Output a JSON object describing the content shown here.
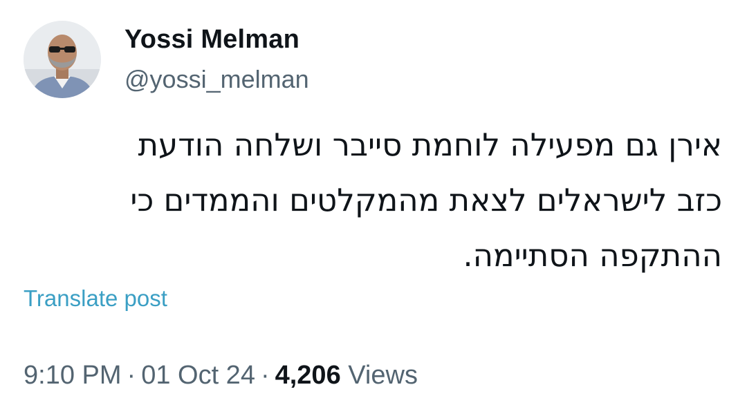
{
  "author": {
    "display_name": "Yossi Melman",
    "handle": "@yossi_melman"
  },
  "post": {
    "lines": [
      "אירן גם מפעילה לוחמת סייבר ושלחה הודעת",
      "כזב לישראלים לצאת מהמקלטים והממדים כי",
      "ההתקפה הסתיימה."
    ]
  },
  "translate_label": "Translate post",
  "meta": {
    "time": "9:10 PM",
    "separator": "·",
    "date": "01 Oct 24",
    "views_count": "4,206",
    "views_label": "Views"
  },
  "colors": {
    "text": "#0f1419",
    "secondary": "#536471",
    "link": "#3b9fc4"
  }
}
